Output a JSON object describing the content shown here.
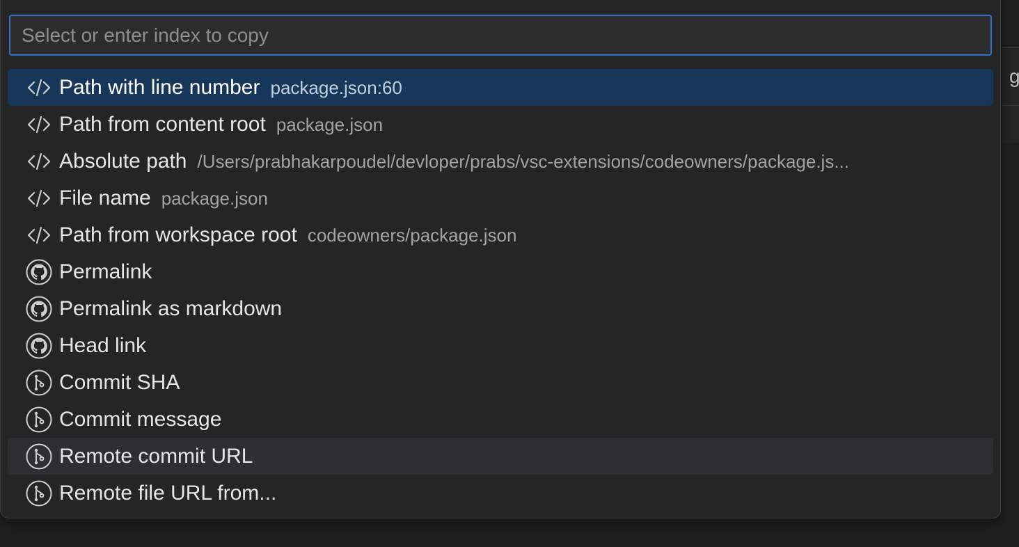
{
  "search": {
    "placeholder": "Select or enter index to copy",
    "value": ""
  },
  "background": {
    "peek_text": "g T"
  },
  "items": [
    {
      "icon": "code-icon",
      "label": "Path with line number",
      "description": "package.json:60",
      "state": "selected"
    },
    {
      "icon": "code-icon",
      "label": "Path from content root",
      "description": "package.json",
      "state": ""
    },
    {
      "icon": "code-icon",
      "label": "Absolute path",
      "description": "/Users/prabhakarpoudel/devloper/prabs/vsc-extensions/codeowners/package.js...",
      "state": ""
    },
    {
      "icon": "code-icon",
      "label": "File name",
      "description": "package.json",
      "state": ""
    },
    {
      "icon": "code-icon",
      "label": "Path from workspace root",
      "description": "codeowners/package.json",
      "state": ""
    },
    {
      "icon": "github-icon",
      "label": "Permalink",
      "description": "",
      "state": ""
    },
    {
      "icon": "github-icon",
      "label": "Permalink as markdown",
      "description": "",
      "state": ""
    },
    {
      "icon": "github-icon",
      "label": "Head link",
      "description": "",
      "state": ""
    },
    {
      "icon": "git-commit-icon",
      "label": "Commit SHA",
      "description": "",
      "state": ""
    },
    {
      "icon": "git-commit-icon",
      "label": "Commit message",
      "description": "",
      "state": ""
    },
    {
      "icon": "git-commit-icon",
      "label": "Remote commit URL",
      "description": "",
      "state": "hovered"
    },
    {
      "icon": "git-commit-icon",
      "label": "Remote file URL from...",
      "description": "",
      "state": ""
    }
  ],
  "colors": {
    "selected_background": "#17375a",
    "hover_background": "#2e2f32",
    "focus_border": "#2f72c9",
    "panel_background": "#252526"
  }
}
